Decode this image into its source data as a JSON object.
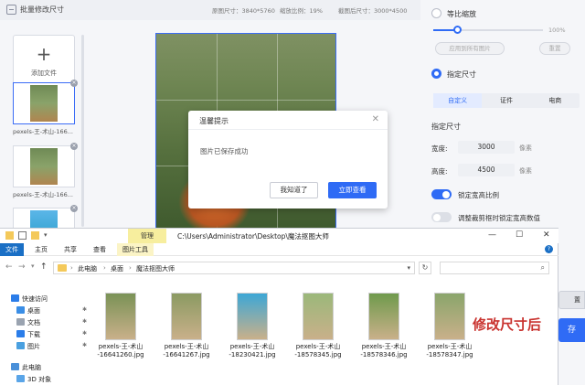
{
  "app": {
    "title": "批量修改尺寸",
    "original_size": "原图尺寸：3840*5760",
    "scale_ratio": "缩放比例：19%",
    "cropped_size": "截图后尺寸：3000*4500",
    "add_file": "添加文件",
    "thumbnails": [
      {
        "caption": "pexels-王-术山-166..."
      },
      {
        "caption": "pexels-王-术山-166..."
      },
      {
        "caption": ""
      }
    ],
    "right_panel": {
      "proportional_scale": "等比缩放",
      "slider_percent_label": "100%",
      "slider_value_fraction": 0.22,
      "apply_all_btn": "应用到所有图片",
      "reset_btn": "重置",
      "specified_size": "指定尺寸",
      "tabs": [
        "自定义",
        "证件",
        "电商"
      ],
      "section_title": "指定尺寸",
      "width_label": "宽度:",
      "width_value": "3000",
      "width_unit": "像素",
      "height_label": "高度:",
      "height_value": "4500",
      "height_unit": "像素",
      "lock_ratio": "锁定宽高比例",
      "lock_ratio_on": true,
      "adjust_crop": "调整裁剪框时锁定宽高数值",
      "adjust_crop_on": false
    },
    "accent_color": "#2f6bf5"
  },
  "dialog": {
    "title": "温馨提示",
    "close": "✕",
    "message": "图片已保存成功",
    "ok_button": "我知道了",
    "view_button": "立即查看"
  },
  "explorer": {
    "manage_tab": "管理",
    "path_title": "C:\\Users\\Administrator\\Desktop\\魔法抠图大师",
    "window_buttons": [
      "—",
      "☐",
      "✕"
    ],
    "ribbon_tabs": {
      "file": "文件",
      "home": "主页",
      "share": "共享",
      "view": "查看",
      "picture_tools": "图片工具"
    },
    "breadcrumbs": [
      "此电脑",
      "桌面",
      "魔法抠图大师"
    ],
    "sidebar": [
      {
        "label": "快速访问",
        "icon": "star-icon",
        "color": "#2b7de9"
      },
      {
        "label": "桌面",
        "icon": "desktop-icon",
        "color": "#3a8ee6",
        "pinned": true
      },
      {
        "label": "文档",
        "icon": "document-icon",
        "color": "#9aa3b0",
        "pinned": true
      },
      {
        "label": "下载",
        "icon": "download-icon",
        "color": "#2b7de9",
        "pinned": true
      },
      {
        "label": "图片",
        "icon": "picture-icon",
        "color": "#4aa0e0",
        "pinned": true
      },
      {
        "label": "此电脑",
        "icon": "computer-icon",
        "color": "#4a90d9"
      },
      {
        "label": "3D 对象",
        "icon": "3d-object-icon",
        "color": "#5aa5e8"
      }
    ],
    "files": [
      {
        "name": "pexels-王-术山\n-16641260.jpg",
        "tint": "#7a9256"
      },
      {
        "name": "pexels-王-术山\n-16641267.jpg",
        "tint": "#8b9a62"
      },
      {
        "name": "pexels-王-术山\n-18230421.jpg",
        "tint": "#3da7d6"
      },
      {
        "name": "pexels-王-术山\n-18578345.jpg",
        "tint": "#9bb87a"
      },
      {
        "name": "pexels-王-术山\n-18578346.jpg",
        "tint": "#6f9a4c"
      },
      {
        "name": "pexels-王-术山\n-18578347.jpg",
        "tint": "#8aa56b"
      }
    ]
  },
  "caption_after": "修改尺寸后",
  "bg_partial_buttons": {
    "grey": "置",
    "blue": "存"
  }
}
